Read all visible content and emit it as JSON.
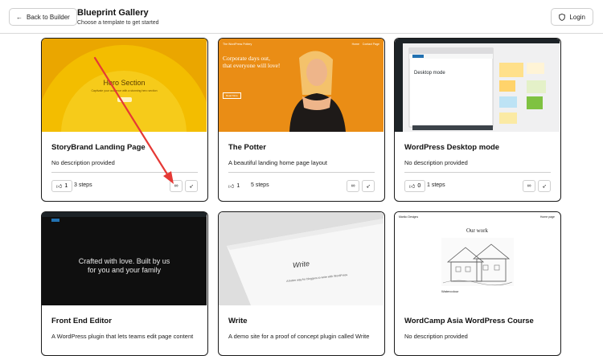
{
  "header": {
    "back_label": "Back to Builder",
    "title": "Blueprint Gallery",
    "subtitle": "Choose a template to get started",
    "login_label": "Login"
  },
  "cards": [
    {
      "title": "StoryBrand Landing Page",
      "description": "No description provided",
      "likes": "1",
      "steps": "3 steps",
      "thumb": {
        "heading": "Hero Section",
        "text": "Captivate your audience with a stunning hero section"
      }
    },
    {
      "title": "The Potter",
      "description": "A beautiful landing home page layout",
      "likes": "1",
      "steps": "5 steps",
      "thumb": {
        "heading": "Corporate days out, that everyone will love!",
        "brand": "The WordPress Pottery",
        "nav": "Home    Contact Page",
        "button": "Read More"
      }
    },
    {
      "title": "WordPress Desktop mode",
      "description": "No description provided",
      "likes": "0",
      "steps": "1 steps",
      "thumb": {
        "heading": "Desktop mode"
      }
    },
    {
      "title": "Front End Editor",
      "description": "A WordPress plugin that lets teams edit page content",
      "thumb": {
        "heading": "Crafted with love. Built by us for you and your family"
      }
    },
    {
      "title": "Write",
      "description": "A demo site for a proof of concept plugin called Write",
      "thumb": {
        "heading": "Write",
        "text": "A better way for bloggers to write with WordPress"
      }
    },
    {
      "title": "WordCamp Asia WordPress Course",
      "description": "No description provided",
      "thumb": {
        "brand": "Mariko Designs",
        "nav": "Home page",
        "heading": "Our work",
        "caption": "Watercolour"
      }
    }
  ],
  "colors": {
    "accent": "#e53935",
    "card_border": "#1a1a1a"
  }
}
